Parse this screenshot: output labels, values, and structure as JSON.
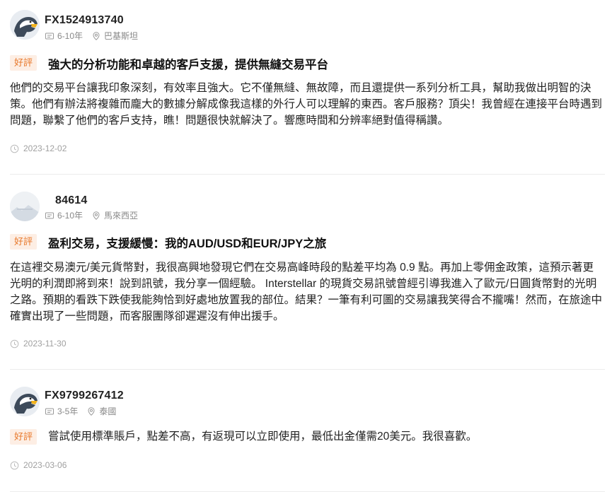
{
  "reviews": [
    {
      "user": "FX1524913740",
      "experience": "6-10年",
      "location": "巴基斯坦",
      "badge": "好評",
      "title": "強大的分析功能和卓越的客戶支援，提供無縫交易平台",
      "body": "他們的交易平台讓我印象深刻，有效率且強大。它不僅無縫、無故障，而且還提供一系列分析工具，幫助我做出明智的決策。他們有辦法將複雜而龐大的數據分解成像我這樣的外行人可以理解的東西。客戶服務？頂尖！我曾經在連接平台時遇到問題，聯繫了他們的客戶支持，瞧！問題很快就解決了。響應時間和分辨率絕對值得稱讚。",
      "date": "2023-12-02",
      "avatar": "eagle-icon"
    },
    {
      "user": "84614",
      "experience": "6-10年",
      "location": "馬來西亞",
      "badge": "好評",
      "title": "盈利交易，支援緩慢：我的AUD/USD和EUR/JPY之旅",
      "body": "在這裡交易澳元/美元貨幣對，我很高興地發現它們在交易高峰時段的點差平均為 0.9 點。再加上零佣金政策，這預示著更光明的利潤即將到來！說到訊號，我分享一個經驗。 Interstellar 的現貨交易訊號曾經引導我進入了歐元/日圓貨幣對的光明之路。預期的看跌下跌使我能夠恰到好處地放置我的部位。結果？一筆有利可圖的交易讓我笑得合不攏嘴！然而，在旅途中確實出現了一些問題，而客服團隊卻遲遲沒有伸出援手。",
      "date": "2023-11-30",
      "avatar": "landscape-avatar-icon"
    },
    {
      "user": "FX9799267412",
      "experience": "3-5年",
      "location": "泰國",
      "badge": "好評",
      "title": "",
      "body": "嘗試使用標準賬戶，點差不高，有返現可以立即使用，最低出金僅需20美元。我很喜歡。",
      "date": "2023-03-06",
      "avatar": "eagle-icon"
    }
  ],
  "colors": {
    "badge_bg": "#fdeee4",
    "badge_text": "#e8782a",
    "meta_text": "#888888",
    "date_text": "#a0a0a0",
    "divider": "#ececec"
  }
}
